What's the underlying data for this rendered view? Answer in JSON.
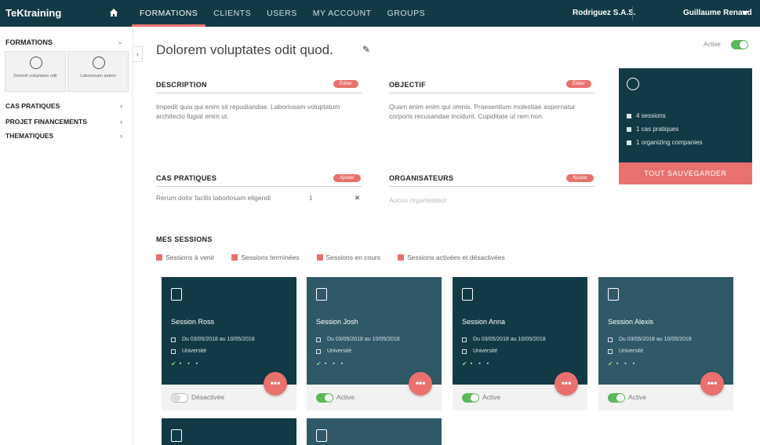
{
  "brand": "TeKtraining",
  "nav": {
    "items": [
      "FORMATIONS",
      "CLIENTS",
      "USERS",
      "MY ACCOUNT",
      "GROUPS"
    ],
    "active_index": 0
  },
  "header_right": {
    "company": "Rodriguez S.A.S.",
    "user": "Guillaume Renaud"
  },
  "sidebar": {
    "heading": "FORMATIONS",
    "tiles": [
      {
        "label": "Deleniti voluptates odit"
      },
      {
        "label": "Laboriosam autem"
      }
    ],
    "items": [
      "CAS PRATIQUES",
      "PROJET FINANCEMENTS",
      "THEMATIQUES"
    ]
  },
  "page": {
    "title": "Dolorem voluptates odit quod.",
    "status_label": "Active"
  },
  "sections": {
    "description": {
      "heading": "DESCRIPTION",
      "action": "Éditer",
      "text": "Impedit quia qui enim sit repudiandae. Laboriosam voluptatum architecto fugiat enim ut."
    },
    "objectif": {
      "heading": "OBJECTIF",
      "action": "Éditer",
      "text": "Quam enim enim qui omnis. Praesentium molestiae aspernatur corporis recusandae incidunt. Cupiditate ut rem non."
    },
    "cas_pratiques": {
      "heading": "CAS PRATIQUES",
      "action": "Ajouter",
      "row_text": "Rerum dolor facilis laboriosam eligendi",
      "row_count": "1"
    },
    "organisateurs": {
      "heading": "ORGANISATEURS",
      "action": "Ajouter",
      "empty_text": "Aucun organisateur"
    }
  },
  "summary": {
    "rows": [
      "4 sessions",
      "1 cas pratiques",
      "1 organizing companies"
    ],
    "button": "TOUT SAUVEGARDER"
  },
  "sessions": {
    "heading": "MES SESSIONS",
    "filters": [
      "Sessions à venir",
      "Sessions terminées",
      "Sessions en cours",
      "Sessions activées et désactivées"
    ],
    "cards": [
      {
        "title": "Session Ross",
        "dates": "Du 03/05/2018 au 10/05/2018",
        "place": "Université",
        "status": "Désactivée",
        "active": false,
        "color": "#123a44"
      },
      {
        "title": "Session Josh",
        "dates": "Du 03/05/2018 au 10/05/2018",
        "place": "Université",
        "status": "Active",
        "active": true,
        "color": "#2f5966"
      },
      {
        "title": "Session Anna",
        "dates": "Du 03/05/2018 au 10/05/2018",
        "place": "Université",
        "status": "Active",
        "active": true,
        "color": "#123a44"
      },
      {
        "title": "Session Alexis",
        "dates": "Du 03/05/2018 au 10/05/2018",
        "place": "Université",
        "status": "Active",
        "active": true,
        "color": "#2f5966"
      }
    ],
    "stubs": [
      {
        "color": "#123a44"
      },
      {
        "color": "#2f5966"
      }
    ]
  },
  "colors": {
    "dark": "#123a44",
    "teal": "#2f5966",
    "accent": "#e8716e",
    "toggle_on": "#5cb85c"
  }
}
